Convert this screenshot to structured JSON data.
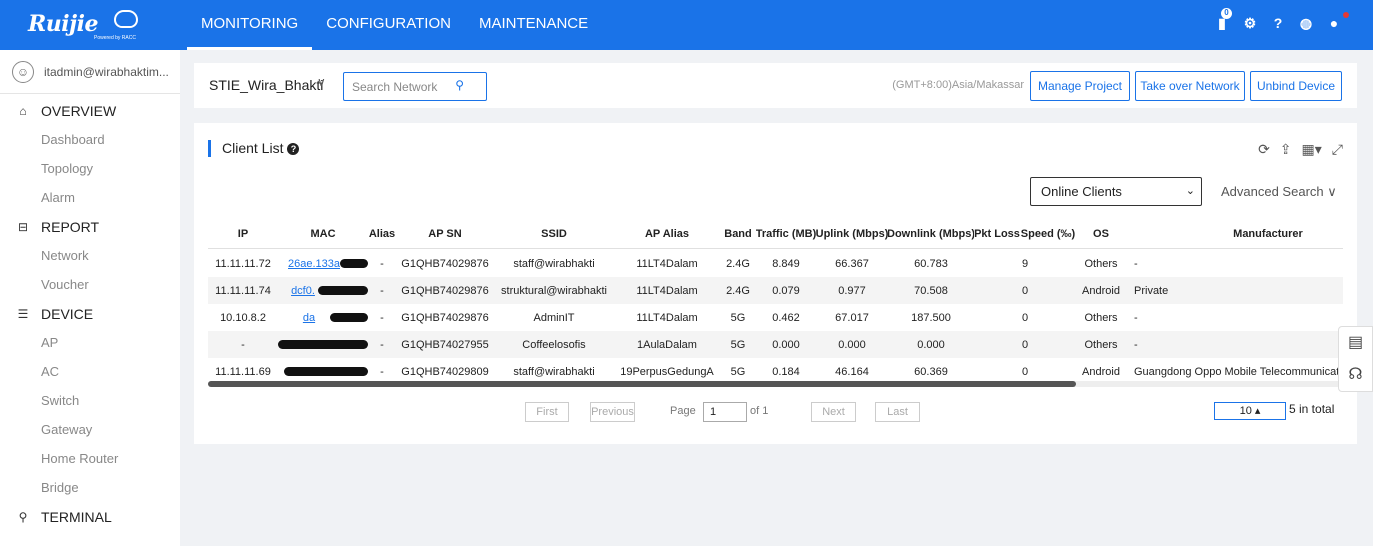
{
  "header": {
    "logo_text": "Ruijie",
    "logo_sub": "Powered by RACC",
    "nav": [
      {
        "label": "MONITORING",
        "active": true
      },
      {
        "label": "CONFIGURATION",
        "active": false
      },
      {
        "label": "MAINTENANCE",
        "active": false
      }
    ],
    "notification_count": "0"
  },
  "sidebar": {
    "user": "itadmin@wirabhaktim...",
    "sections": [
      {
        "label": "OVERVIEW",
        "icon": "home-icon",
        "items": [
          "Dashboard",
          "Topology",
          "Alarm"
        ]
      },
      {
        "label": "REPORT",
        "icon": "report-icon",
        "items": [
          "Network",
          "Voucher"
        ]
      },
      {
        "label": "DEVICE",
        "icon": "device-icon",
        "items": [
          "AP",
          "AC",
          "Switch",
          "Gateway",
          "Home Router",
          "Bridge"
        ]
      },
      {
        "label": "TERMINAL",
        "icon": "terminal-icon",
        "items": []
      }
    ]
  },
  "toolbar": {
    "project": "STIE_Wira_Bhakti",
    "search_placeholder": "Search Network",
    "timezone": "(GMT+8:00)Asia/Makassar",
    "manage_project": "Manage Project",
    "take_over": "Take over Network",
    "unbind": "Unbind Device"
  },
  "client_list": {
    "title": "Client List",
    "filter": "Online Clients",
    "advanced_search": "Advanced Search",
    "columns": [
      "IP",
      "MAC",
      "Alias",
      "AP SN",
      "SSID",
      "AP Alias",
      "Band",
      "Traffic (MB)",
      "Uplink (Mbps)",
      "Downlink (Mbps)",
      "Pkt Loss",
      "Speed (‰)",
      "OS",
      "Manufacturer"
    ],
    "rows": [
      {
        "ip": "11.11.11.72",
        "mac": "26ae.133a",
        "alias": "-",
        "ap_sn": "G1QHB74029876",
        "ssid": "staff@wirabhakti",
        "ap_alias": "11LT4Dalam",
        "band": "2.4G",
        "traffic": "8.849",
        "uplink": "66.367",
        "downlink": "60.783",
        "speed": "9",
        "os": "Others",
        "manufacturer": "-"
      },
      {
        "ip": "11.11.11.74",
        "mac": "dcf0.",
        "alias": "-",
        "ap_sn": "G1QHB74029876",
        "ssid": "struktural@wirabhakti",
        "ap_alias": "11LT4Dalam",
        "band": "2.4G",
        "traffic": "0.079",
        "uplink": "0.977",
        "downlink": "70.508",
        "speed": "0",
        "os": "Android",
        "manufacturer": "Private"
      },
      {
        "ip": "10.10.8.2",
        "mac": "da",
        "alias": "-",
        "ap_sn": "G1QHB74029876",
        "ssid": "AdminIT",
        "ap_alias": "11LT4Dalam",
        "band": "5G",
        "traffic": "0.462",
        "uplink": "67.017",
        "downlink": "187.500",
        "speed": "0",
        "os": "Others",
        "manufacturer": "-"
      },
      {
        "ip": "-",
        "mac": "",
        "alias": "-",
        "ap_sn": "G1QHB74027955",
        "ssid": "Coffeelosofis",
        "ap_alias": "1AulaDalam",
        "band": "5G",
        "traffic": "0.000",
        "uplink": "0.000",
        "downlink": "0.000",
        "speed": "0",
        "os": "Others",
        "manufacturer": "-"
      },
      {
        "ip": "11.11.11.69",
        "mac": "",
        "alias": "-",
        "ap_sn": "G1QHB74029809",
        "ssid": "staff@wirabhakti",
        "ap_alias": "19PerpusGedungA",
        "band": "5G",
        "traffic": "0.184",
        "uplink": "46.164",
        "downlink": "60.369",
        "speed": "0",
        "os": "Android",
        "manufacturer": "Guangdong Oppo Mobile Telecommunications"
      }
    ]
  },
  "pagination": {
    "first": "First",
    "previous": "Previous",
    "page_label": "Page",
    "page_value": "1",
    "of_label": "of 1",
    "next": "Next",
    "last": "Last",
    "page_size": "10 ▴",
    "total": "5 in total"
  }
}
